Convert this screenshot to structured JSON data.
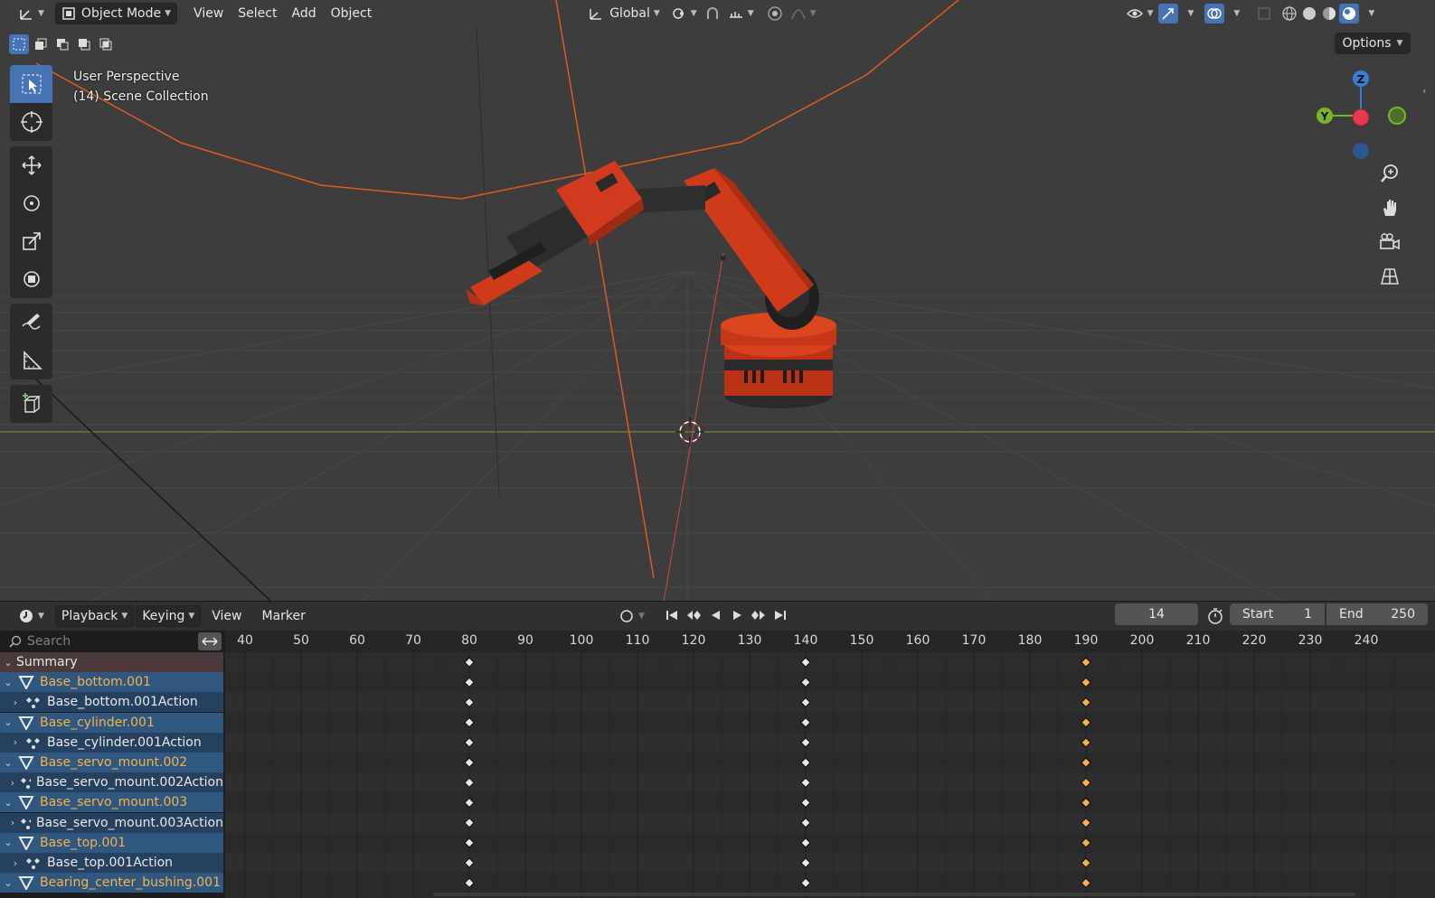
{
  "header": {
    "mode": "Object Mode",
    "menus": [
      "View",
      "Select",
      "Add",
      "Object"
    ],
    "orientation": "Global"
  },
  "viewport": {
    "perspective": "User Perspective",
    "collection": "(14) Scene Collection",
    "options_label": "Options",
    "gizmo": {
      "z": "Z",
      "y": "Y"
    }
  },
  "timeline": {
    "menus": {
      "playback": "Playback",
      "keying": "Keying",
      "view": "View",
      "marker": "Marker"
    },
    "current_frame": "14",
    "start_label": "Start",
    "start_value": "1",
    "end_label": "End",
    "end_value": "250",
    "search_placeholder": "Search",
    "ruler_ticks": [
      "40",
      "50",
      "60",
      "70",
      "80",
      "90",
      "100",
      "110",
      "120",
      "130",
      "140",
      "150",
      "160",
      "170",
      "180",
      "190",
      "200",
      "210",
      "220",
      "230",
      "240"
    ],
    "keyframe_frames": [
      80,
      140,
      190
    ],
    "selected_keyframe_frame": 190
  },
  "channels": [
    {
      "type": "summary",
      "label": "Summary"
    },
    {
      "type": "object",
      "label": "Base_bottom.001"
    },
    {
      "type": "action",
      "label": "Base_bottom.001Action"
    },
    {
      "type": "object",
      "label": "Base_cylinder.001"
    },
    {
      "type": "action",
      "label": "Base_cylinder.001Action"
    },
    {
      "type": "object",
      "label": "Base_servo_mount.002"
    },
    {
      "type": "action",
      "label": "Base_servo_mount.002Action"
    },
    {
      "type": "object",
      "label": "Base_servo_mount.003"
    },
    {
      "type": "action",
      "label": "Base_servo_mount.003Action"
    },
    {
      "type": "object",
      "label": "Base_top.001"
    },
    {
      "type": "action",
      "label": "Base_top.001Action"
    },
    {
      "type": "object",
      "label": "Bearing_center_bushing.001"
    }
  ],
  "colors": {
    "accent": "#4772b3",
    "object_label": "#f4b34a",
    "robot": "#d13a1e",
    "selected_key": "#f4b34a"
  }
}
